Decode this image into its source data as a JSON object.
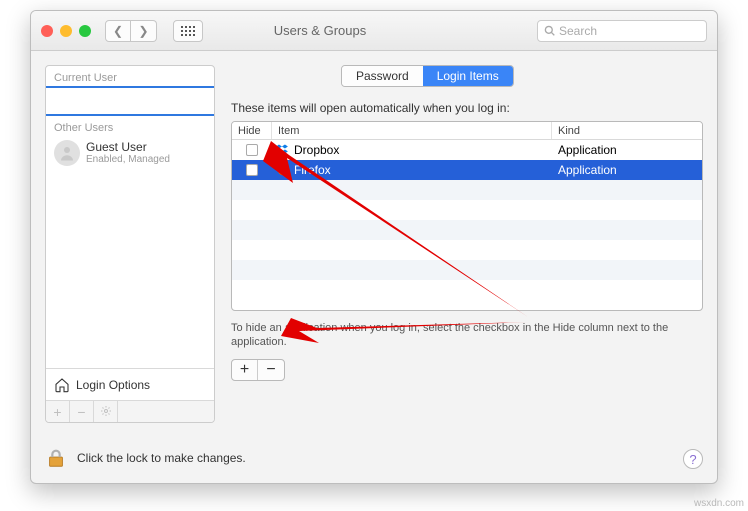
{
  "window": {
    "title": "Users & Groups"
  },
  "search": {
    "placeholder": "Search"
  },
  "sidebar": {
    "current_label": "Current User",
    "other_label": "Other Users",
    "guest": {
      "name": "Guest User",
      "status": "Enabled, Managed"
    },
    "login_options": "Login Options"
  },
  "tabs": {
    "password": "Password",
    "login_items": "Login Items"
  },
  "main": {
    "desc": "These items will open automatically when you log in:",
    "headers": {
      "hide": "Hide",
      "item": "Item",
      "kind": "Kind"
    },
    "rows": [
      {
        "item": "Dropbox",
        "kind": "Application",
        "icon": "dropbox"
      },
      {
        "item": "Firefox",
        "kind": "Application",
        "icon": "firefox"
      }
    ],
    "note": "To hide an application when you log in, select the checkbox in the Hide column next to the application.",
    "plus": "+",
    "minus": "−"
  },
  "footer": {
    "lock_text": "Click the lock to make changes.",
    "help": "?"
  },
  "watermark": "wsxdn.com"
}
